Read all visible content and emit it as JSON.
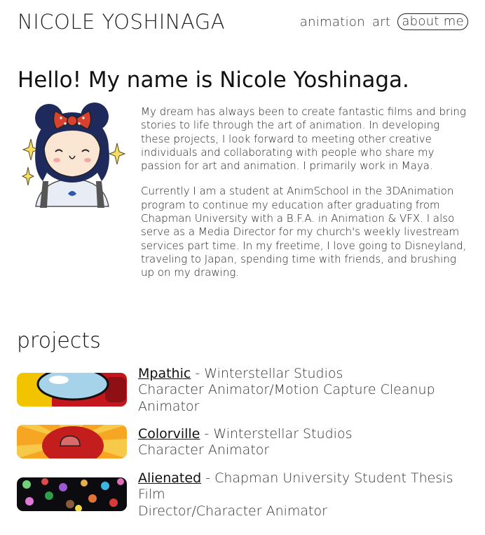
{
  "header": {
    "site_title": "NICOLE YOSHINAGA",
    "nav": [
      {
        "label": "animation",
        "active": false
      },
      {
        "label": "art",
        "active": false
      },
      {
        "label": "about me",
        "active": true
      }
    ]
  },
  "about": {
    "heading": "Hello! My name is Nicole Yoshinaga.",
    "paragraphs": [
      "My dream has always been to create fantastic films and bring stories to life through the art of animation. In developing these projects, I look forward to meeting other creative individuals and collaborating with people who share my passion for art and animation. I primarily work in Maya.",
      "Currently I am a student at AnimSchool in the 3DAnimation program to continue my education after graduating from Chapman University with a B.F.A. in Animation & VFX. I also serve as a Media Director for my church's weekly livestream services part time. In my freetime, I love going to Disneyland, traveling to Japan, spending time with friends, and brushing up on my drawing."
    ]
  },
  "projects": {
    "heading": "projects",
    "items": [
      {
        "title": "Mpathic",
        "studio": " - Winterstellar Studios",
        "role": "Character Animator/Motion Capture Cleanup Animator"
      },
      {
        "title": "Colorville",
        "studio": " - Winterstellar Studios",
        "role": "Character Animator"
      },
      {
        "title": "Alienated",
        "studio": " - Chapman University Student Thesis Film",
        "role": "Director/Character Animator"
      }
    ]
  },
  "colors": {
    "accent": "#111111",
    "bow": "#d9412f",
    "hair": "#1f2a5c"
  }
}
